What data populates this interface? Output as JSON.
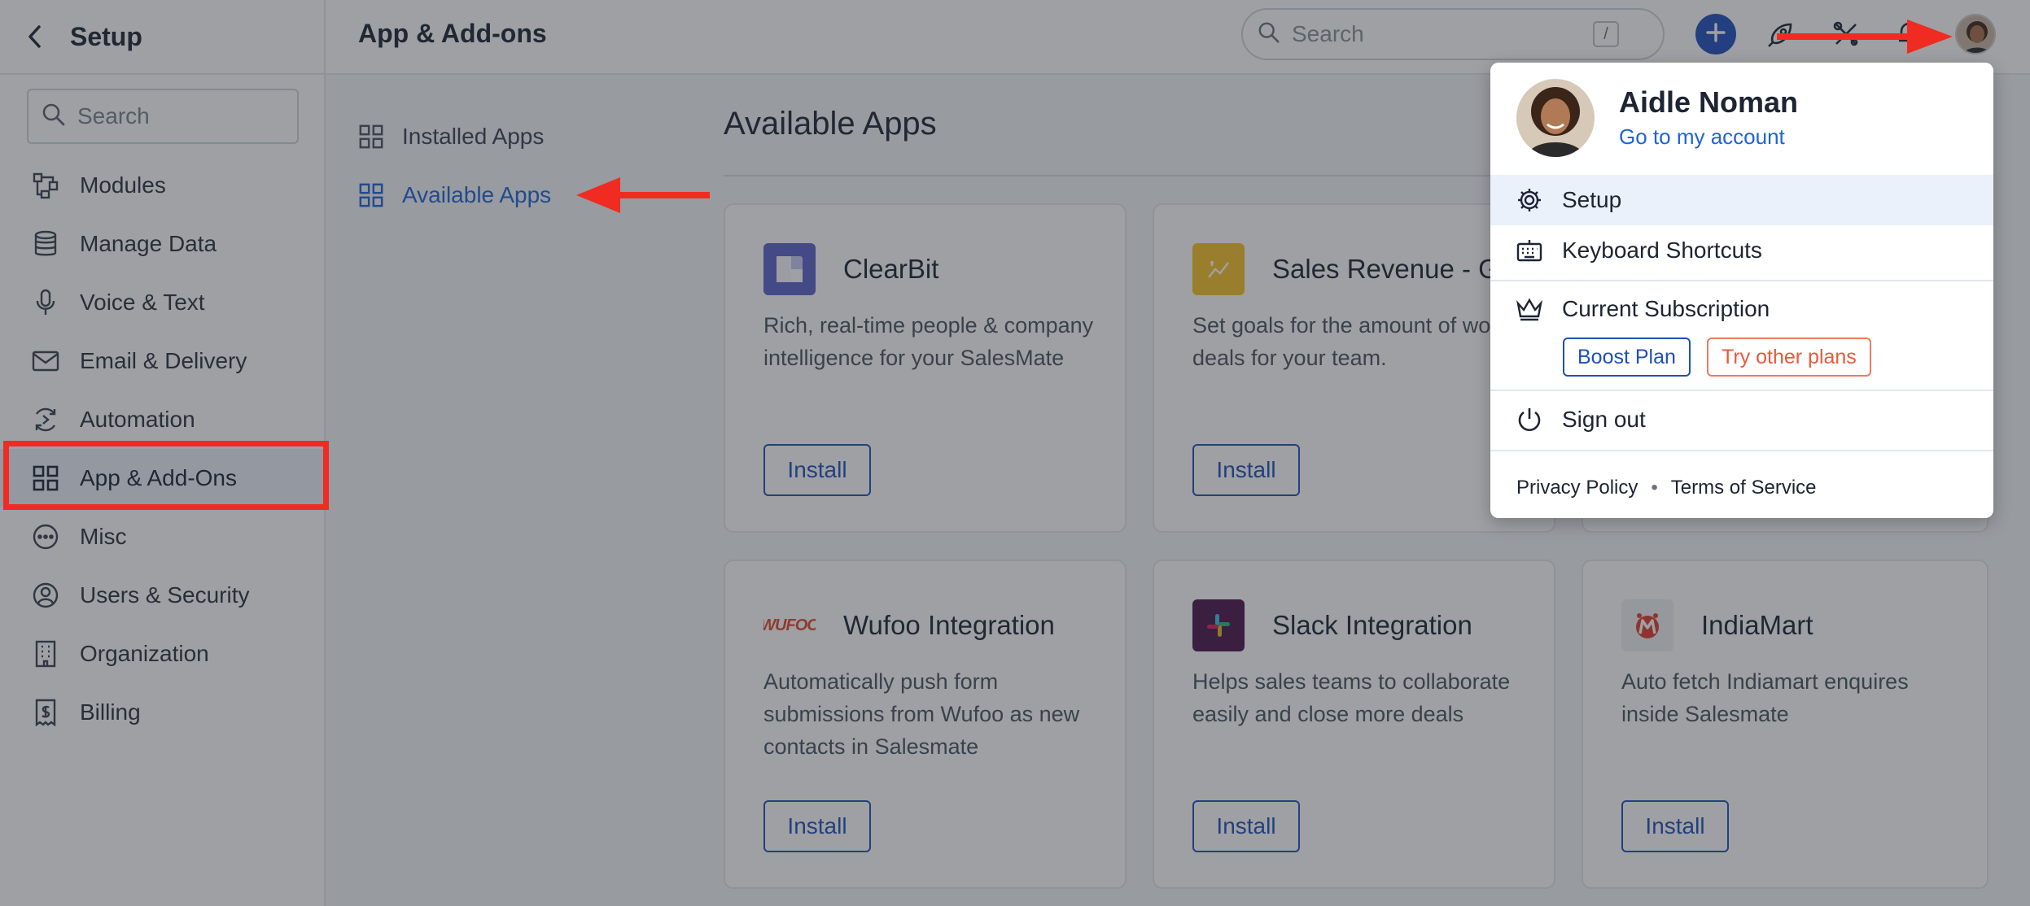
{
  "sidebar": {
    "title": "Setup",
    "search_placeholder": "Search",
    "items": [
      {
        "label": "Modules",
        "icon": "modules-icon"
      },
      {
        "label": "Manage Data",
        "icon": "database-icon"
      },
      {
        "label": "Voice & Text",
        "icon": "microphone-icon"
      },
      {
        "label": "Email & Delivery",
        "icon": "mail-icon"
      },
      {
        "label": "Automation",
        "icon": "automation-icon"
      },
      {
        "label": "App & Add-Ons",
        "icon": "grid-icon",
        "active": true
      },
      {
        "label": "Misc",
        "icon": "more-icon"
      },
      {
        "label": "Users & Security",
        "icon": "user-circle-icon"
      },
      {
        "label": "Organization",
        "icon": "building-icon"
      },
      {
        "label": "Billing",
        "icon": "receipt-icon"
      }
    ]
  },
  "header": {
    "title": "App & Add-ons",
    "search_placeholder": "Search",
    "search_shortcut": "/"
  },
  "subnav": {
    "items": [
      {
        "label": "Installed Apps",
        "icon": "grid-icon"
      },
      {
        "label": "Available Apps",
        "icon": "grid-icon",
        "active": true
      }
    ]
  },
  "main": {
    "title": "Available Apps",
    "cards": [
      {
        "name": "ClearBit",
        "description": "Rich, real-time people & company intelligence for your SalesMate",
        "button": "Install",
        "logo": "clearbit-logo"
      },
      {
        "name": "Sales Revenue - G",
        "description": "Set goals for the amount of won deals for your team.",
        "button": "Install",
        "logo": "sales-revenue-logo"
      },
      {
        "name": "Wufoo Integration",
        "description": "Automatically push form submissions from Wufoo as new contacts in Salesmate",
        "button": "Install",
        "logo": "wufoo-logo",
        "logo_text": "WUFOO"
      },
      {
        "name": "Slack Integration",
        "description": "Helps sales teams to collaborate easily and close more deals",
        "button": "Install",
        "logo": "slack-logo"
      },
      {
        "name": "IndiaMart",
        "description": "Auto fetch Indiamart enquires inside Salesmate",
        "button": "Install",
        "logo": "indiamart-logo"
      }
    ]
  },
  "profile_menu": {
    "name": "Aidle Noman",
    "account_link": "Go to my account",
    "setup": "Setup",
    "shortcuts": "Keyboard Shortcuts",
    "subscription": "Current Subscription",
    "plan": "Boost Plan",
    "other_plans": "Try other plans",
    "sign_out": "Sign out",
    "privacy": "Privacy Policy",
    "separator": "•",
    "terms": "Terms of Service"
  },
  "colors": {
    "accent": "#1f4fbf",
    "link": "#1f63d6",
    "annotation": "#f02b21"
  }
}
